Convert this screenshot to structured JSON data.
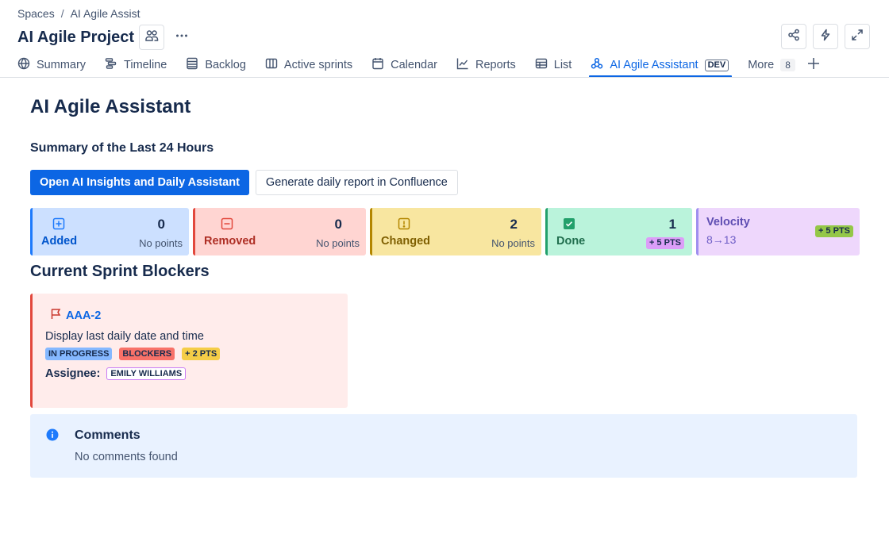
{
  "breadcrumb": {
    "root": "Spaces",
    "separator": "/",
    "current": "AI Agile Assist"
  },
  "project": {
    "title": "AI Agile Project",
    "more_label": "More actions"
  },
  "tabs": [
    {
      "label": "Summary",
      "icon": "globe-icon"
    },
    {
      "label": "Timeline",
      "icon": "timeline-icon"
    },
    {
      "label": "Backlog",
      "icon": "backlog-icon"
    },
    {
      "label": "Active sprints",
      "icon": "board-icon"
    },
    {
      "label": "Calendar",
      "icon": "calendar-icon"
    },
    {
      "label": "Reports",
      "icon": "chart-line-icon"
    },
    {
      "label": "List",
      "icon": "table-icon"
    },
    {
      "label": "AI Agile Assistant",
      "icon": "app-icon",
      "badge": "DEV",
      "active": true
    },
    {
      "label": "More",
      "count": "8"
    }
  ],
  "page": {
    "title": "AI Agile Assistant",
    "summary_heading": "Summary of the Last 24 Hours",
    "primary_button": "Open AI Insights and Daily Assistant",
    "secondary_button": "Generate daily report in Confluence"
  },
  "stats": {
    "added": {
      "label": "Added",
      "count": "0",
      "sub": "No points",
      "icon": "plus-square-icon",
      "color": "#1d7afc"
    },
    "removed": {
      "label": "Removed",
      "count": "0",
      "sub": "No points",
      "icon": "minus-square-icon",
      "color": "#e2483d"
    },
    "changed": {
      "label": "Changed",
      "count": "2",
      "sub": "No points",
      "icon": "warning-square-icon",
      "color": "#b38600"
    },
    "done": {
      "label": "Done",
      "count": "1",
      "badge": "+ 5 PTS",
      "icon": "check-square-icon",
      "color": "#22a06b"
    },
    "velocity": {
      "label": "Velocity",
      "value": "8→13",
      "badge": "+ 5 PTS",
      "color": "#9f8fef"
    }
  },
  "blockers": {
    "heading": "Current Sprint Blockers",
    "items": [
      {
        "key": "AAA-2",
        "summary": "Display last daily date and time",
        "status": "IN PROGRESS",
        "label": "BLOCKERS",
        "points": "+ 2 PTS",
        "assignee_label": "Assignee:",
        "assignee": "EMILY WILLIAMS"
      }
    ]
  },
  "comments": {
    "title": "Comments",
    "empty": "No comments found"
  },
  "colors": {
    "accent": "#0c66e4",
    "text": "#172b4d",
    "subtle": "#44546f"
  }
}
